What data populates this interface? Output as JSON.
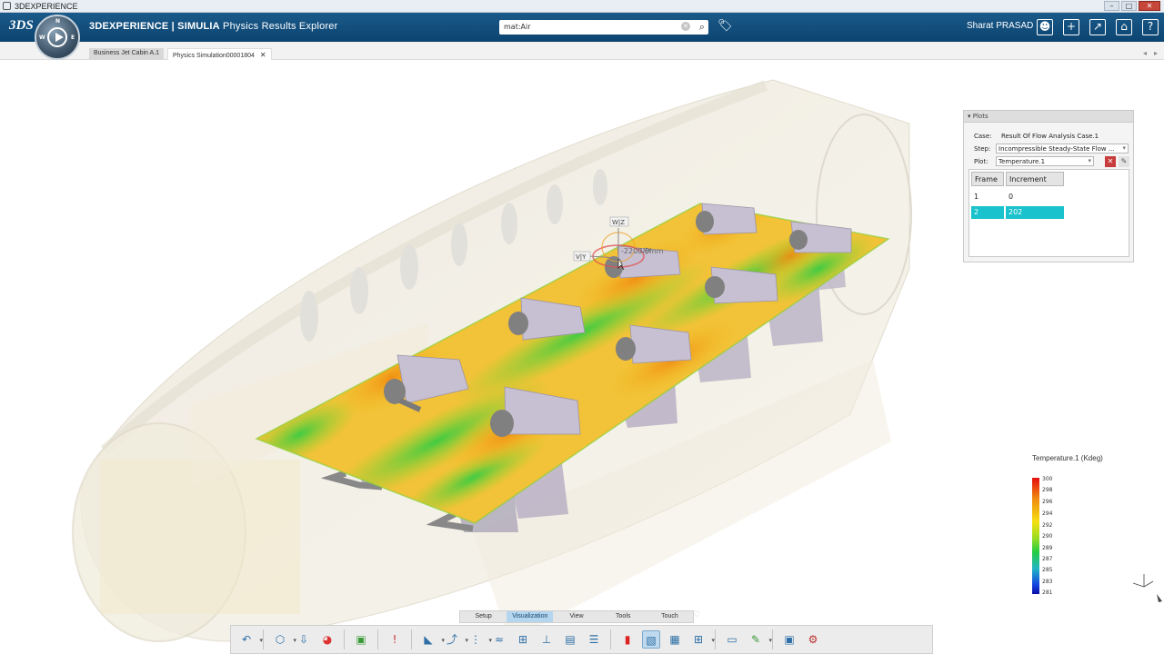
{
  "window": {
    "title": "3DEXPERIENCE"
  },
  "header": {
    "brand_prefix": "3DEXPERIENCE | SIMULIA",
    "brand_app": " Physics Results Explorer",
    "search_value": "mat:Air",
    "user_name": "Sharat PRASAD"
  },
  "tabs": [
    {
      "label": "Business Jet Cabin A.1"
    },
    {
      "label": "Physics Simulation00001804"
    }
  ],
  "viewport": {
    "triad_w_label": "W|Z",
    "triad_v_label": "V|Y",
    "triad_u_label": "U|X",
    "triad_value": "-2200.6mm"
  },
  "plots_panel": {
    "title": "Plots",
    "case_label": "Case:",
    "case_value": "Result Of Flow Analysis Case.1",
    "step_label": "Step:",
    "step_value": "Incompressible Steady-State Flow ...",
    "plot_label": "Plot:",
    "plot_value": "Temperature.1",
    "columns": [
      "Frame",
      "Increment"
    ],
    "rows": [
      {
        "frame": "1",
        "increment": "0"
      },
      {
        "frame": "2",
        "increment": "202"
      }
    ],
    "selected_row": 1
  },
  "legend": {
    "title": "Temperature.1 (Kdeg)",
    "ticks": [
      "300",
      "298",
      "296",
      "294",
      "292",
      "290",
      "289",
      "287",
      "285",
      "283",
      "281"
    ],
    "colors": [
      "#e51010",
      "#f08a10",
      "#f5e010",
      "#99dd22",
      "#22cc44",
      "#21b6c4",
      "#1546e0",
      "#0c0ca6"
    ]
  },
  "bottom_tabs": [
    "Setup",
    "Visualization",
    "View",
    "Tools",
    "Touch"
  ],
  "active_bottom_tab": "Visualization",
  "colors": {
    "accent": "#0c4470",
    "selection": "#19c2cc",
    "active_tab": "#b4d6ee"
  }
}
